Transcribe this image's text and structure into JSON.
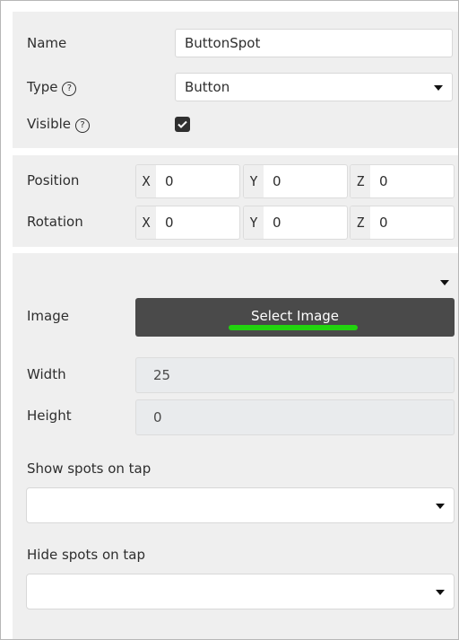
{
  "general": {
    "name_label": "Name",
    "name_value": "ButtonSpot",
    "type_label": "Type",
    "type_value": "Button",
    "visible_label": "Visible",
    "help_glyph": "?",
    "visible_checked": true
  },
  "transform": {
    "position_label": "Position",
    "rotation_label": "Rotation",
    "position": [
      {
        "axis": "X",
        "value": "0"
      },
      {
        "axis": "Y",
        "value": "0"
      },
      {
        "axis": "Z",
        "value": "0"
      }
    ],
    "rotation": [
      {
        "axis": "X",
        "value": "0"
      },
      {
        "axis": "Y",
        "value": "0"
      },
      {
        "axis": "Z",
        "value": "0"
      }
    ]
  },
  "button_settings": {
    "image_label": "Image",
    "select_image_label": "Select Image",
    "width_label": "Width",
    "width_value": "25",
    "height_label": "Height",
    "height_value": "0",
    "show_spots_label": "Show spots on tap",
    "show_spots_value": "",
    "hide_spots_label": "Hide spots on tap",
    "hide_spots_value": ""
  },
  "colors": {
    "panel_bg": "#efefef",
    "button_dark": "#4a4a4a",
    "highlight_green": "#22d30f",
    "readonly_bg": "#e9ebed"
  },
  "icons": [
    "help-circle-icon",
    "checkmark-icon",
    "caret-down-icon"
  ]
}
